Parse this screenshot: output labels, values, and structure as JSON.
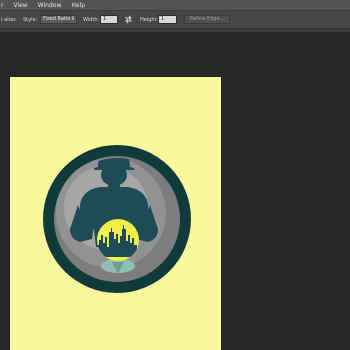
{
  "menu": {
    "items": [
      "r",
      "View",
      "Window",
      "Help"
    ]
  },
  "options": {
    "antialias_label": "i-alias",
    "style_label": "Style:",
    "style_value": "Fixed Ratio",
    "width_label": "Width:",
    "width_value": "1",
    "height_label": "Height:",
    "height_value": "1",
    "refine_label": "Refine Edge..."
  },
  "icons": {
    "swap": "swap-arrows-icon",
    "dropdown": "dropdown-arrow-icon"
  },
  "colors": {
    "canvas_background": "#fbf89c",
    "workspace": "#282828",
    "circle_outer": "#0f3b3b",
    "circle_inner": "#8c8c8c",
    "figure": "#1f4b57",
    "sun": "#f1ef4a",
    "water": "#8fbfb0"
  }
}
